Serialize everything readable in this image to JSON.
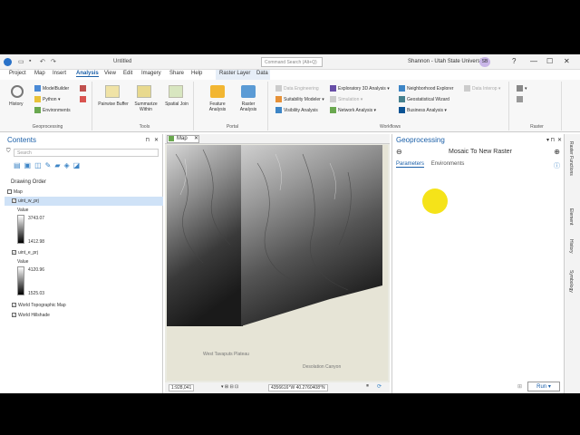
{
  "titlebar": {
    "doc_title": "Untitled",
    "search_placeholder": "Command Search (Alt+Q)",
    "user": "Shannon - Utah State University",
    "avatar_initials": "SB",
    "help": "?",
    "minimize": "—",
    "maximize": "☐",
    "close": "✕"
  },
  "menu": {
    "tabs": [
      "Project",
      "Map",
      "Insert",
      "Analysis",
      "View",
      "Edit",
      "Imagery",
      "Share",
      "Help",
      "Raster Layer",
      "Data"
    ],
    "active": "Analysis"
  },
  "ribbon": {
    "geoprocessing": {
      "label": "Geoprocessing",
      "history": "History",
      "modelbuilder": "ModelBuilder",
      "python": "Python",
      "environments": "Environments"
    },
    "tools": {
      "label": "Tools",
      "items": [
        "Pairwise Buffer",
        "Summarize Within",
        "Spatial Join"
      ]
    },
    "portal": {
      "label": "Portal",
      "feature_analysis": "Feature Analysis",
      "raster_analysis": "Raster Analysis"
    },
    "workflows": {
      "label": "Workflows",
      "data_engineering": "Data Engineering",
      "suitability_modeler": "Suitability Modeler",
      "visibility_analysis": "Visibility Analysis",
      "exploratory_3d": "Exploratory 3D Analysis",
      "simulation": "Simulation",
      "network_analysis": "Network Analysis",
      "neighborhood_explorer": "Neighborhood Explorer",
      "geostatistical_wizard": "Geostatistical Wizard",
      "business_analysis": "Business Analysis",
      "data_interop": "Data Interop"
    },
    "raster": {
      "label": "Raster"
    }
  },
  "contents": {
    "title": "Contents",
    "search_placeholder": "Search",
    "drawing_order": "Drawing Order",
    "map": "Map",
    "layers": [
      {
        "name": "uint_w_prj",
        "value_label": "Value",
        "max": "3743.07",
        "min": "1412.98"
      },
      {
        "name": "uint_e_prj",
        "value_label": "Value",
        "max": "4120.96",
        "min": "1525.03"
      }
    ],
    "basemaps": [
      "World Topographic Map",
      "World Hillshade"
    ]
  },
  "mapview": {
    "tab": "Map",
    "scale": "1:928,041",
    "coords": "4356616°W 40.2760408°N",
    "labels": [
      "West Tavaputs Plateau",
      "Desolation Canyon"
    ]
  },
  "geoprocessing": {
    "title": "Geoprocessing",
    "tool_name": "Mosaic To New Raster",
    "tabs": [
      "Parameters",
      "Environments"
    ],
    "run": "Run"
  },
  "side_tabs": [
    "Raster Functions",
    "Element",
    "History",
    "Symbology"
  ],
  "colors": {
    "accent": "#1a5fa8",
    "cursor_highlight": "#f4e000"
  }
}
